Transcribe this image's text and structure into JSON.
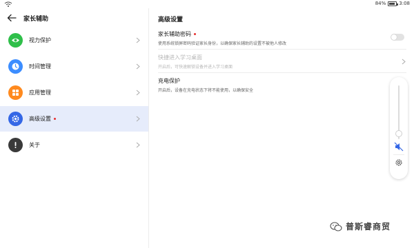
{
  "status": {
    "battery": "84%",
    "time": "3:08"
  },
  "left": {
    "title": "家长辅助",
    "items": [
      {
        "label": "视力保护",
        "icon": "eye-icon",
        "color": "#2fbf4a"
      },
      {
        "label": "时间管理",
        "icon": "clock-icon",
        "color": "#3c8dff"
      },
      {
        "label": "应用管理",
        "icon": "apps-icon",
        "color": "#ff8a1f"
      },
      {
        "label": "高级设置",
        "icon": "gear-icon",
        "color": "#3467e6",
        "active": true
      },
      {
        "label": "关于",
        "icon": "info-icon",
        "color": "#3a3a3a"
      }
    ]
  },
  "right": {
    "title": "高级设置",
    "settings": [
      {
        "title": "家长辅助密码",
        "desc": "使用系统锁屏密码验证家长身份，以确保家长辅助的设置不被他人修改",
        "control": "toggle",
        "toggle_on": false
      },
      {
        "title": "快捷进入学习桌面",
        "desc": "开启后，可快速解锁设备并进入学习桌面",
        "control": "chevron",
        "disabled": true
      },
      {
        "title": "充电保护",
        "desc": "开启后，设备在充电状态下将不能使用，以确保安全"
      }
    ]
  },
  "volume": {
    "level": 0.1
  },
  "watermark": {
    "text": "普斯睿商贸"
  }
}
